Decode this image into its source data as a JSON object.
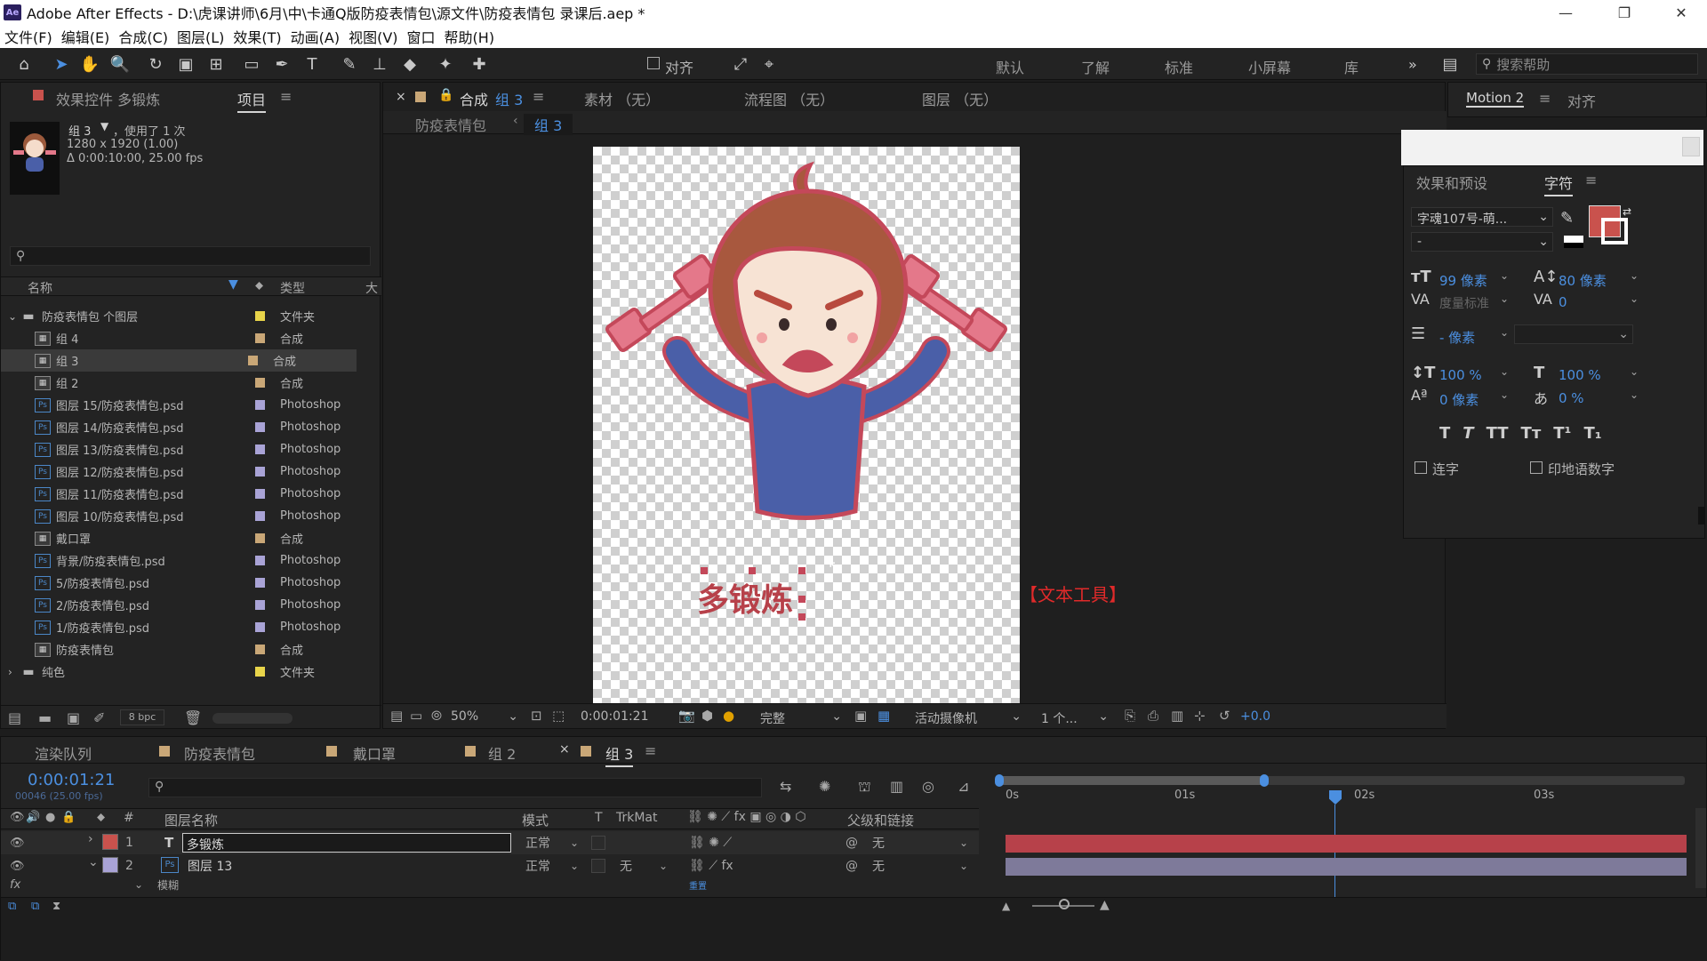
{
  "window": {
    "title": "Adobe After Effects - D:\\虎课讲师\\6月\\中\\卡通Q版防疫表情包\\源文件\\防疫表情包 录课后.aep *",
    "logo": "Ae",
    "minimize": "—",
    "maximize": "❐",
    "close": "✕"
  },
  "menu": [
    "文件(F)",
    "编辑(E)",
    "合成(C)",
    "图层(L)",
    "效果(T)",
    "动画(A)",
    "视图(V)",
    "窗口",
    "帮助(H)"
  ],
  "toolbar": {
    "snap_label": "对齐",
    "workspaces": [
      "默认",
      "了解",
      "标准",
      "小屏幕",
      "库"
    ],
    "more": "»",
    "search_placeholder": "搜索帮助"
  },
  "project": {
    "tab_effects": "效果控件 多锻炼",
    "tab_project": "项目",
    "selected_name": "组 3",
    "used_count": "，使用了 1 次",
    "dimensions": "1280 x 1920 (1.00)",
    "duration": "Δ 0:00:10:00, 25.00 fps",
    "search_placeholder": "",
    "col_name": "名称",
    "col_type": "类型",
    "col_size": "大",
    "bpc": "8 bpc",
    "items": [
      {
        "name": "防疫表情包 个图层",
        "type": "文件夹",
        "kind": "folder",
        "color": "#e8d44a",
        "open": "⌄"
      },
      {
        "name": "组 4",
        "type": "合成",
        "kind": "comp",
        "color": "#c9a777"
      },
      {
        "name": "组 3",
        "type": "合成",
        "kind": "comp",
        "color": "#c9a777"
      },
      {
        "name": "组 2",
        "type": "合成",
        "kind": "comp",
        "color": "#c9a777"
      },
      {
        "name": "图层  15/防疫表情包.psd",
        "type": "Photoshop",
        "kind": "ps",
        "color": "#a9a3d6"
      },
      {
        "name": "图层  14/防疫表情包.psd",
        "type": "Photoshop",
        "kind": "ps",
        "color": "#a9a3d6"
      },
      {
        "name": "图层  13/防疫表情包.psd",
        "type": "Photoshop",
        "kind": "ps",
        "color": "#a9a3d6"
      },
      {
        "name": "图层  12/防疫表情包.psd",
        "type": "Photoshop",
        "kind": "ps",
        "color": "#a9a3d6"
      },
      {
        "name": "图层  11/防疫表情包.psd",
        "type": "Photoshop",
        "kind": "ps",
        "color": "#a9a3d6"
      },
      {
        "name": "图层  10/防疫表情包.psd",
        "type": "Photoshop",
        "kind": "ps",
        "color": "#a9a3d6"
      },
      {
        "name": "戴口罩",
        "type": "合成",
        "kind": "comp",
        "color": "#c9a777"
      },
      {
        "name": "背景/防疫表情包.psd",
        "type": "Photoshop",
        "kind": "ps",
        "color": "#a9a3d6"
      },
      {
        "name": "5/防疫表情包.psd",
        "type": "Photoshop",
        "kind": "ps",
        "color": "#a9a3d6"
      },
      {
        "name": "2/防疫表情包.psd",
        "type": "Photoshop",
        "kind": "ps",
        "color": "#a9a3d6"
      },
      {
        "name": "1/防疫表情包.psd",
        "type": "Photoshop",
        "kind": "ps",
        "color": "#a9a3d6"
      },
      {
        "name": "防疫表情包",
        "type": "合成",
        "kind": "comp",
        "color": "#c9a777"
      },
      {
        "name": "纯色",
        "type": "文件夹",
        "kind": "folder",
        "color": "#e8d44a",
        "open": "›"
      }
    ]
  },
  "composition": {
    "tab_comp_prefix": "合成",
    "tab_comp_name": "组 3",
    "tab_footage": "素材  （无）",
    "tab_flow": "流程图  （无）",
    "tab_layer": "图层  （无）",
    "breadcrumb_parent": "防疫表情包",
    "breadcrumb_current": "组 3",
    "canvas_text": "多锻炼",
    "annotation": "【文本工具】",
    "zoom": "50%",
    "timecode": "0:00:01:21",
    "resolution": "完整",
    "camera": "活动摄像机",
    "views": "1 个...",
    "exposure": "+0.0"
  },
  "right": {
    "tab_motion": "Motion 2",
    "tab_align": "对齐",
    "tab_effects_presets": "效果和预设",
    "tab_character": "字符",
    "font_name": "字魂107号-萌...",
    "font_style": "-",
    "fill_color": "#c9524d",
    "font_size": "99 像素",
    "leading": "80 像素",
    "kerning": "度量标准",
    "tracking": "0",
    "stroke_width": "- 像素",
    "vscale": "100 %",
    "hscale": "100 %",
    "baseline": "0 像素",
    "tsume": "0 %",
    "style_buttons": [
      "T",
      "T",
      "TT",
      "Tт",
      "T¹",
      "T₁"
    ],
    "ligature_label": "连字",
    "hindi_label": "印地语数字"
  },
  "timeline": {
    "tabs": [
      {
        "label": "渲染队列",
        "color": ""
      },
      {
        "label": "防疫表情包",
        "color": "#c9a777"
      },
      {
        "label": "戴口罩",
        "color": "#c9a777"
      },
      {
        "label": "组 2",
        "color": "#c9a777"
      },
      {
        "label": "组 3",
        "color": "#c9a777"
      }
    ],
    "timecode": "0:00:01:21",
    "frame_info": "00046 (25.00 fps)",
    "col_num": "#",
    "col_layer_name": "图层名称",
    "col_mode": "模式",
    "col_t": "T",
    "col_trkmat": "TrkMat",
    "col_parent": "父级和链接",
    "ruler": [
      "0s",
      "01s",
      "02s",
      "03s"
    ],
    "layers": [
      {
        "num": "1",
        "name": "多锻炼",
        "kind": "T",
        "mode": "正常",
        "trkmat": "",
        "parent": "无",
        "color": "#c9524d"
      },
      {
        "num": "2",
        "name": "图层 13",
        "kind": "Ps",
        "mode": "正常",
        "trkmat": "无",
        "parent": "无",
        "color": "#a9a3d6"
      }
    ],
    "sub_row": "模糊",
    "sub_row_value": "重置"
  }
}
